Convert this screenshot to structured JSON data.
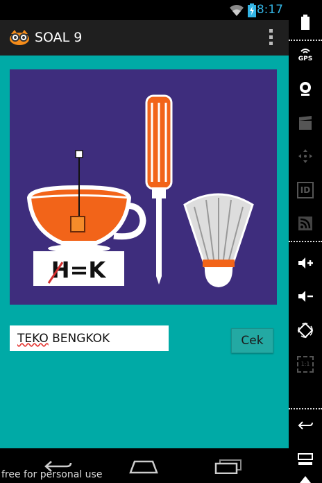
{
  "status_bar": {
    "time": "8:17"
  },
  "action_bar": {
    "title": "SOAL 9",
    "app_icon": "owl-glasses-icon",
    "menu_icon": "overflow-menu-icon"
  },
  "puzzle": {
    "sign_text": "H=K",
    "items": [
      "teacup-icon",
      "screwdriver-icon",
      "shuttlecock-icon"
    ]
  },
  "answer": {
    "first_word": "TEKO",
    "second_word": "BENGKOK"
  },
  "check_button": {
    "label": "Cek"
  },
  "nav_bar": {
    "buttons": [
      "back-icon",
      "home-icon",
      "recents-icon"
    ]
  },
  "watermark": "free for personal use",
  "side_panel": {
    "gps_label": "GPS",
    "id_label": "ID",
    "scale_label": "1:1",
    "icons": [
      "battery-icon",
      "gps-icon",
      "camera-icon",
      "clapper-icon",
      "dpad-icon",
      "id-icon",
      "rss-icon",
      "volume-up-icon",
      "volume-down-icon",
      "rotate-icon",
      "scale-icon",
      "back-icon",
      "menu-icon",
      "home-icon"
    ]
  },
  "colors": {
    "background": "#00aaa6",
    "puzzle_bg": "#3e2d7d",
    "accent_orange": "#f26419",
    "status_time": "#33b5e5"
  }
}
